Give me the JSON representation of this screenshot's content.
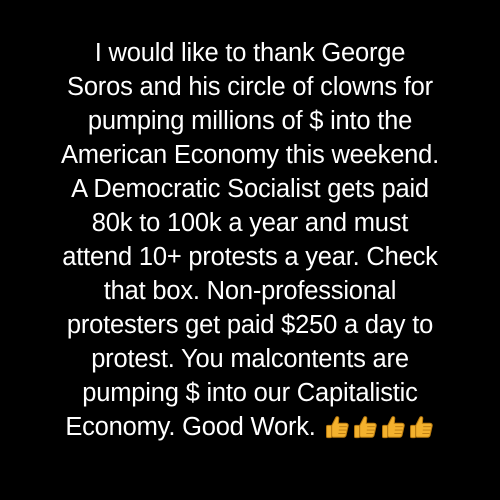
{
  "post": {
    "lines": [
      "I would like to thank George",
      "Soros and his circle of clowns for",
      "pumping millions of $ into the",
      "American Economy this weekend.",
      "A Democratic Socialist gets paid",
      "80k to 100k a year and must",
      "attend 10+ protests a year. Check",
      "that box. Non-professional",
      "protesters get paid $250 a day to",
      "protest. You malcontents are",
      "pumping $ into our Capitalistic"
    ],
    "last_line": "Economy. Good Work.",
    "emoji": [
      "thumbs-up-icon",
      "thumbs-up-icon",
      "thumbs-up-icon",
      "thumbs-up-icon"
    ]
  },
  "colors": {
    "background": "#000000",
    "text": "#ffffff",
    "emoji": "#F4B22E"
  }
}
